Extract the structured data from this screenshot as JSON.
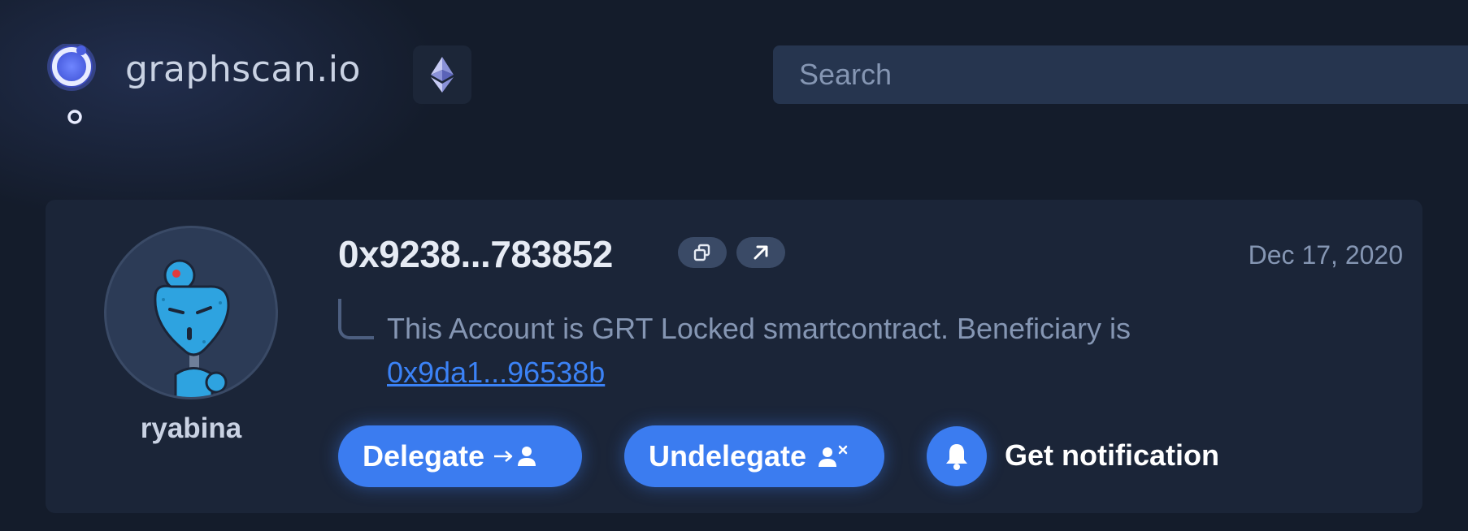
{
  "header": {
    "logo_text": "graphscan.io",
    "network_icon": "ethereum-icon",
    "search": {
      "placeholder": "Search",
      "value": ""
    }
  },
  "account": {
    "address": "0x9238...783852",
    "date": "Dec 17, 2020",
    "username": "ryabina",
    "avatar_icon": "robot-avatar",
    "description": "This Account is GRT Locked smartcontract. Beneficiary is",
    "beneficiary": "0x9da1...96538b"
  },
  "actions": {
    "delegate_label": "Delegate",
    "undelegate_label": "Undelegate",
    "notification_label": "Get notification"
  },
  "colors": {
    "background": "#141c2b",
    "card": "#1b2538",
    "accent": "#3b7cf0",
    "link": "#3b82f6",
    "muted_text": "#8596b3"
  }
}
